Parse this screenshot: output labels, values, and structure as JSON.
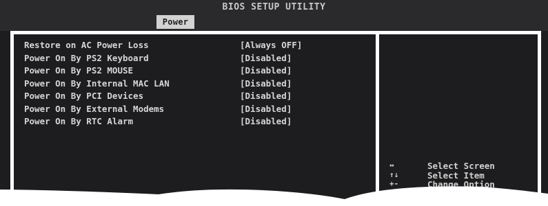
{
  "header": {
    "title": "BIOS SETUP UTILITY",
    "active_tab": "Power"
  },
  "settings": [
    {
      "label": "Restore on AC Power Loss",
      "value": "[Always OFF]"
    },
    {
      "label": "Power On By PS2 Keyboard",
      "value": "[Disabled]"
    },
    {
      "label": "Power On By PS2 MOUSE",
      "value": "[Disabled]"
    },
    {
      "label": "Power On By Internal MAC LAN",
      "value": "[Disabled]"
    },
    {
      "label": "Power On By PCI Devices",
      "value": "[Disabled]"
    },
    {
      "label": "Power On By External Modems",
      "value": "[Disabled]"
    },
    {
      "label": "Power On By RTC Alarm",
      "value": "[Disabled]"
    }
  ],
  "help": [
    {
      "key": "↔",
      "description": "Select Screen"
    },
    {
      "key": "↑↓",
      "description": "Select Item"
    },
    {
      "key": "+-",
      "description": "Change Option"
    }
  ],
  "colors": {
    "background": "#1d1d1f",
    "text": "#d6d6d6",
    "frame": "#ffffff",
    "tab_highlight": "#d2d2d2"
  }
}
